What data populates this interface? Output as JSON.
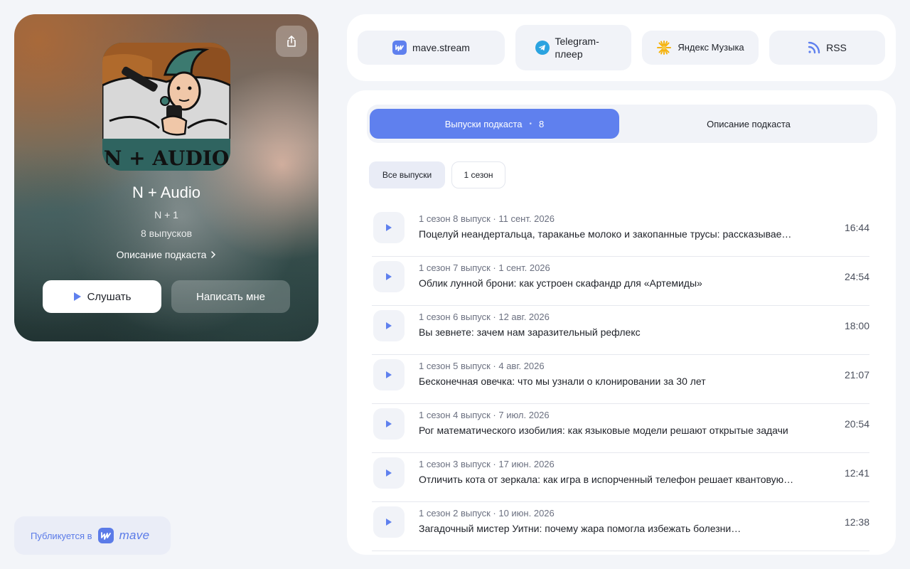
{
  "podcast": {
    "title": "N + Audio",
    "author": "N + 1",
    "episode_count": "8 выпусков",
    "description_link": "Описание подкаста",
    "cover_text": "N + AUDIO",
    "listen_label": "Слушать",
    "write_label": "Написать мне"
  },
  "published": {
    "label": "Публикуется в",
    "brand": "mave"
  },
  "platforms": [
    {
      "label": "mave.stream",
      "icon": "mave-icon"
    },
    {
      "label": "Telegram-плеер",
      "icon": "telegram-icon"
    },
    {
      "label": "Яндекс Музыка",
      "icon": "yandex-music-icon"
    },
    {
      "label": "RSS",
      "icon": "rss-icon"
    }
  ],
  "tabs": {
    "episodes_label": "Выпуски подкаста",
    "episodes_count": "8",
    "description_label": "Описание подкаста"
  },
  "filters": {
    "all": "Все выпуски",
    "season1": "1 сезон"
  },
  "colors": {
    "accent": "#5f80ee",
    "panel_bg": "#f1f3f8",
    "page_bg": "#f3f5f9"
  },
  "episodes": [
    {
      "meta": "1 сезон 8 выпуск · 11 сент. 2026",
      "title": "Поцелуй неандертальца, тараканье молоко и закопанные трусы: рассказывае…",
      "duration": "16:44"
    },
    {
      "meta": "1 сезон 7 выпуск · 1 сент. 2026",
      "title": "Облик лунной брони: как устроен скафандр для «Артемиды»",
      "duration": "24:54"
    },
    {
      "meta": "1 сезон 6 выпуск · 12 авг. 2026",
      "title": "Вы зевнете: зачем нам заразительный рефлекс",
      "duration": "18:00"
    },
    {
      "meta": "1 сезон 5 выпуск · 4 авг. 2026",
      "title": "Бесконечная овечка: что мы узнали о клонировании за 30 лет",
      "duration": "21:07"
    },
    {
      "meta": "1 сезон 4 выпуск · 7 июл. 2026",
      "title": "Рог математического изобилия: как языковые модели решают открытые задачи",
      "duration": "20:54"
    },
    {
      "meta": "1 сезон 3 выпуск · 17 июн. 2026",
      "title": "Отличить кота от зеркала: как игра в испорченный телефон решает квантовую…",
      "duration": "12:41"
    },
    {
      "meta": "1 сезон 2 выпуск · 10 июн. 2026",
      "title": "Загадочный мистер Уитни: почему жара помогла избежать болезни…",
      "duration": "12:38"
    }
  ]
}
